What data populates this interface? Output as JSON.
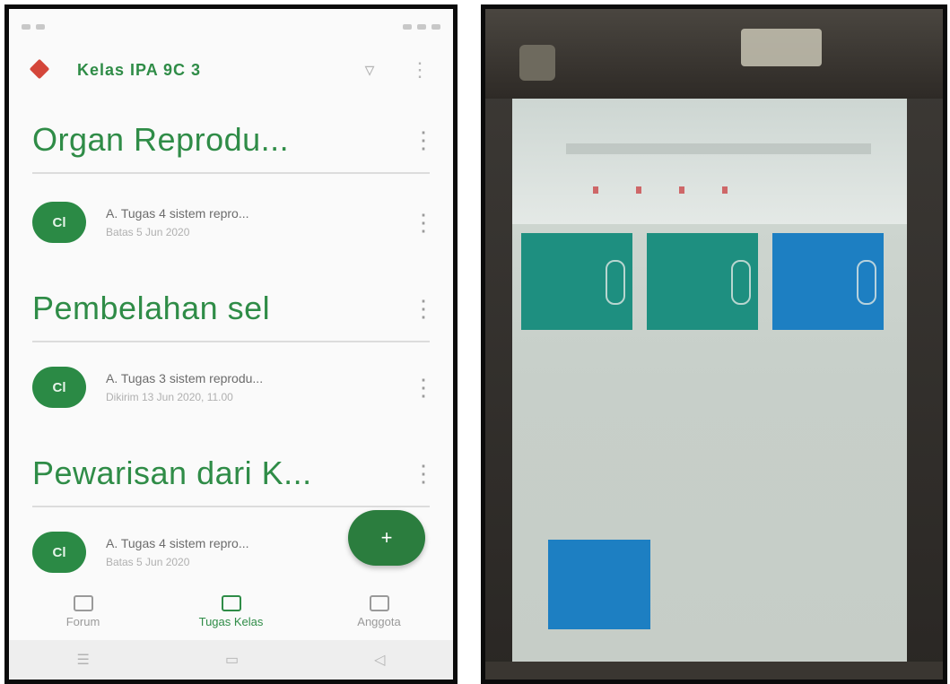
{
  "left_app": {
    "app_bar_title": "Kelas IPA 9C 3",
    "topics": [
      {
        "title": "Organ Reprodu...",
        "assignment": {
          "icon_label": "Cl",
          "title": "A. Tugas 4 sistem repro...",
          "subtitle": "Batas 5 Jun 2020"
        }
      },
      {
        "title": "Pembelahan sel",
        "assignment": {
          "icon_label": "Cl",
          "title": "A. Tugas 3 sistem reprodu...",
          "subtitle": "Dikirim 13 Jun 2020, 11.00"
        }
      },
      {
        "title": "Pewarisan dari K...",
        "assignment": {
          "icon_label": "Cl",
          "title": "A. Tugas 4 sistem repro...",
          "subtitle": "Batas 5 Jun 2020"
        }
      }
    ],
    "fab_label": "+",
    "bottom_nav": [
      {
        "label": "Forum",
        "active": false
      },
      {
        "label": "Tugas Kelas",
        "active": true
      },
      {
        "label": "Anggota",
        "active": false
      }
    ],
    "colors": {
      "accent": "#2f8c47",
      "fab": "#2b7d3e",
      "back_icon": "#d4463a"
    }
  },
  "right_device": {
    "tiles": [
      {
        "color": "teal"
      },
      {
        "color": "teal"
      },
      {
        "color": "blue"
      }
    ],
    "colors": {
      "teal": "#1e8f80",
      "blue": "#1d7fc2",
      "screen_bg": "#c7cfc9"
    }
  }
}
